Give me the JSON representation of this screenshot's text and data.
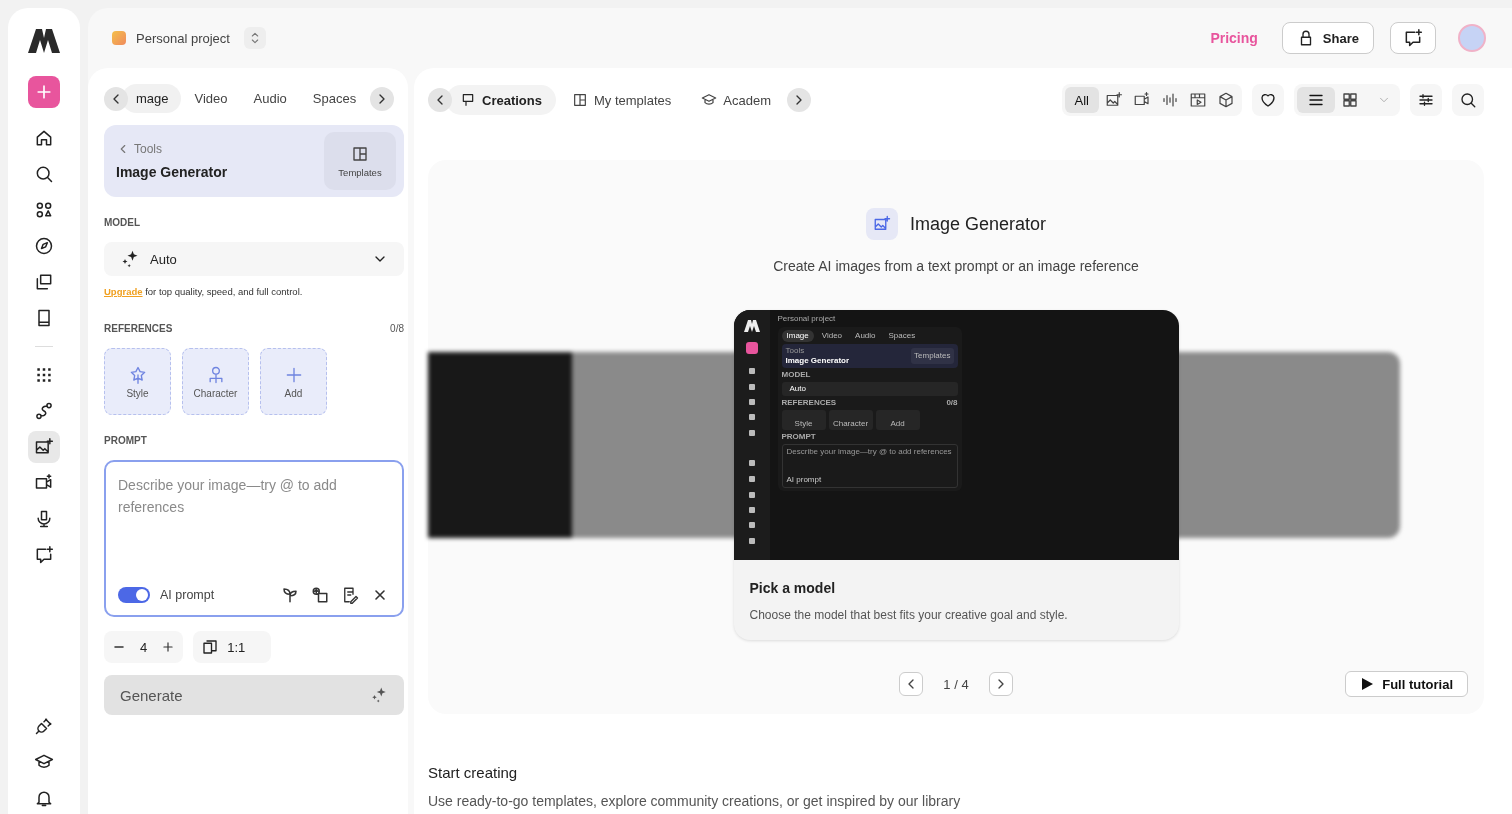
{
  "header": {
    "project": "Personal project",
    "pricing": "Pricing",
    "share": "Share"
  },
  "rail": {
    "top": [
      {
        "kind": "home",
        "selected": false
      },
      {
        "kind": "search",
        "selected": false
      },
      {
        "kind": "apps",
        "selected": false
      },
      {
        "kind": "compass",
        "selected": false
      },
      {
        "kind": "layers",
        "selected": false
      },
      {
        "kind": "book",
        "selected": false
      }
    ],
    "middle": [
      {
        "kind": "grid",
        "selected": false
      },
      {
        "kind": "route",
        "selected": false
      },
      {
        "kind": "image",
        "selected": true
      },
      {
        "kind": "video",
        "selected": false
      },
      {
        "kind": "mic",
        "selected": false
      },
      {
        "kind": "chatplus",
        "selected": false
      }
    ],
    "bottom": [
      {
        "kind": "plug",
        "selected": false
      },
      {
        "kind": "cap",
        "selected": false
      },
      {
        "kind": "bell",
        "selected": false
      }
    ]
  },
  "left_panel": {
    "tabs": [
      {
        "label": "mage",
        "selected": true
      },
      {
        "label": "Video",
        "selected": false
      },
      {
        "label": "Audio",
        "selected": false
      },
      {
        "label": "Spaces",
        "selected": false
      }
    ],
    "tool_card": {
      "back": "Tools",
      "title": "Image Generator",
      "templates": "Templates"
    },
    "model": {
      "label": "MODEL",
      "value": "Auto",
      "upgrade_link": "Upgrade",
      "upgrade_text": " for top quality, speed, and full control."
    },
    "references": {
      "label": "REFERENCES",
      "count": "0/8",
      "items": [
        {
          "kind": "style",
          "label": "Style"
        },
        {
          "kind": "character",
          "label": "Character"
        },
        {
          "kind": "add",
          "label": "Add"
        }
      ]
    },
    "prompt": {
      "label": "PROMPT",
      "placeholder": "Describe your image—try @ to add references",
      "ai_prompt": {
        "label": "AI prompt",
        "on": true
      }
    },
    "count": "4",
    "ratio": "1:1",
    "generate": "Generate"
  },
  "right_panel": {
    "tabs": [
      {
        "kind": "creations",
        "label": "Creations",
        "selected": true
      },
      {
        "kind": "templates",
        "label": "My templates",
        "selected": false
      },
      {
        "kind": "academy",
        "label": "Academ",
        "selected": false
      }
    ],
    "filters": [
      {
        "kind": "all",
        "label": "All",
        "selected": true
      },
      {
        "kind": "image",
        "selected": false
      },
      {
        "kind": "video",
        "selected": false
      },
      {
        "kind": "audio",
        "selected": false
      },
      {
        "kind": "storyboard",
        "selected": false
      },
      {
        "kind": "cube",
        "selected": false
      }
    ],
    "views": [
      {
        "kind": "list",
        "selected": true
      },
      {
        "kind": "grid4",
        "selected": false
      }
    ],
    "hero": {
      "title": "Image Generator",
      "subtitle": "Create AI images from a text prompt or an image reference",
      "slide": {
        "title": "Pick a model",
        "text": "Choose the model that best fits your creative goal and style.",
        "screenshot": {
          "project": "Personal project",
          "tabs": [
            {
              "label": "Image",
              "selected": true
            },
            {
              "label": "Video",
              "selected": false
            },
            {
              "label": "Audio",
              "selected": false
            },
            {
              "label": "Spaces",
              "selected": false
            }
          ],
          "back": "Tools",
          "title": "Image Generator",
          "templates": "Templates",
          "model_label": "MODEL",
          "model": "Auto",
          "refs_label": "REFERENCES",
          "refs_count": "0/8",
          "refs": [
            "Style",
            "Character",
            "Add"
          ],
          "prompt_label": "PROMPT",
          "placeholder": "Describe your image—try @ to add references",
          "ai_prompt": "AI prompt"
        }
      },
      "pager": "1 / 4",
      "tutorial": "Full tutorial"
    },
    "start": {
      "title": "Start creating",
      "text": "Use ready-to-go templates, explore community creations, or get inspired by our library"
    }
  }
}
